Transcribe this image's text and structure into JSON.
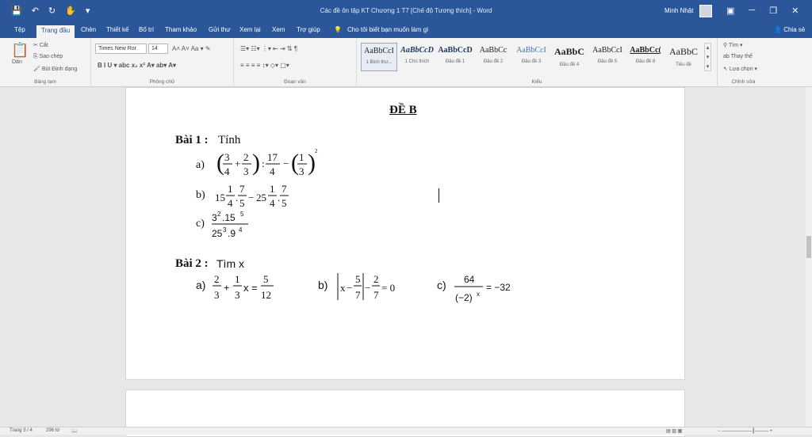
{
  "window": {
    "title": "Các đề ôn tập KT Chương 1 T7 [Chế độ Tương thích] - Word",
    "user": "Minh Nhật",
    "share": "Chia sẻ"
  },
  "tabs": [
    "Tệp",
    "Trang đầu",
    "Chèn",
    "Thiết kế",
    "Bố trí",
    "Tham khảo",
    "Gửi thư",
    "Xem lại",
    "Xem",
    "Trợ giúp"
  ],
  "tellme": "Cho tôi biết bạn muốn làm gì",
  "ribbon": {
    "clipboard": {
      "paste": "Dán",
      "cut": "Cắt",
      "copy": "Sao chép",
      "format": "Bút Định dạng",
      "label": "Bảng tạm"
    },
    "font": {
      "name": "Times New Ror",
      "size": "14",
      "label": "Phông chữ"
    },
    "paragraph": {
      "label": "Đoạn văn"
    },
    "styles": {
      "label": "Kiểu",
      "items": [
        {
          "sample": "AaBbCcI",
          "name": "1 Bình thư..."
        },
        {
          "sample": "AaBbCcD",
          "name": "1 Chú thích"
        },
        {
          "sample": "AaBbCcD",
          "name": "Đầu đề 1"
        },
        {
          "sample": "AaBbCc",
          "name": "Đầu đề 2"
        },
        {
          "sample": "AaBbCcI",
          "name": "Đầu đề 3"
        },
        {
          "sample": "AaBbC",
          "name": "Đầu đề 4"
        },
        {
          "sample": "AaBbCcI",
          "name": "Đầu đề 5"
        },
        {
          "sample": "AaBbCc(",
          "name": "Đầu đề 8"
        },
        {
          "sample": "AaBbC",
          "name": "Tiêu đề"
        }
      ]
    },
    "editing": {
      "find": "Tìm",
      "replace": "Thay thế",
      "select": "Lựa chọn",
      "label": "Chỉnh sửa"
    }
  },
  "document": {
    "heading": "ĐỀ B",
    "bai1_label": "Bài 1 :",
    "bai1_title": "Tính",
    "bai2_label": "Bài 2 :",
    "bai2_title": "Tìm x",
    "items": {
      "a1": "a)",
      "b1": "b)",
      "c1": "c)",
      "a2": "a)",
      "b2": "b)",
      "c2": "c)"
    }
  },
  "status": {
    "page": "Trang 3 / 4",
    "words": "296 từ"
  },
  "colors": {
    "accent": "#2b579a"
  }
}
